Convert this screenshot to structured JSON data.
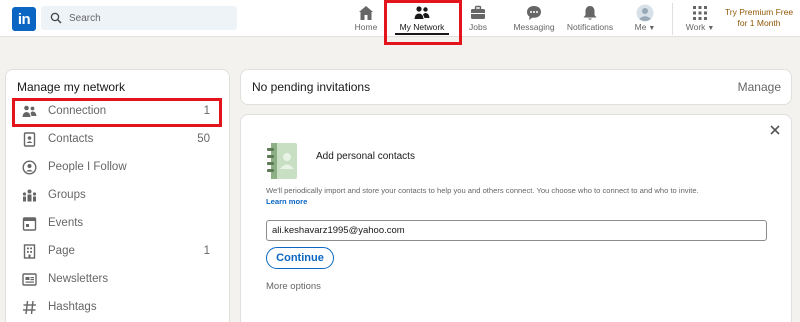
{
  "topbar": {
    "logo_text": "in",
    "search_placeholder": "Search",
    "nav": [
      {
        "label": "Home",
        "icon": "home-icon"
      },
      {
        "label": "My Network",
        "icon": "network-icon",
        "active": true
      },
      {
        "label": "Jobs",
        "icon": "briefcase-icon"
      },
      {
        "label": "Messaging",
        "icon": "messaging-icon"
      },
      {
        "label": "Notifications",
        "icon": "bell-icon"
      },
      {
        "label": "Me",
        "icon": "avatar-icon"
      },
      {
        "label": "Work",
        "icon": "grid-icon"
      }
    ],
    "premium_line1": "Try Premium Free",
    "premium_line2": "for 1 Month"
  },
  "sidebar": {
    "title": "Manage my network",
    "items": [
      {
        "label": "Connection",
        "count": "1",
        "icon": "people-icon"
      },
      {
        "label": "Contacts",
        "count": "50",
        "icon": "contact-book-icon"
      },
      {
        "label": "People I Follow",
        "count": "",
        "icon": "person-follow-icon"
      },
      {
        "label": "Groups",
        "count": "",
        "icon": "groups-icon"
      },
      {
        "label": "Events",
        "count": "",
        "icon": "calendar-icon"
      },
      {
        "label": "Page",
        "count": "1",
        "icon": "building-icon"
      },
      {
        "label": "Newsletters",
        "count": "",
        "icon": "newsletter-icon"
      },
      {
        "label": "Hashtags",
        "count": "",
        "icon": "hashtag-icon"
      }
    ]
  },
  "invitations": {
    "text": "No pending invitations",
    "manage_label": "Manage"
  },
  "contacts_card": {
    "title": "Add personal contacts",
    "description": "We'll periodically import and store your contacts to help you and others connect. You choose who to connect to and who to invite.",
    "learn_more": "Learn more",
    "email_value": "ali.keshavarz1995@yahoo.com",
    "continue_label": "Continue",
    "more_options": "More options"
  },
  "colors": {
    "brand": "#0a66c2",
    "highlight": "#e3141b",
    "premium": "#915907"
  }
}
